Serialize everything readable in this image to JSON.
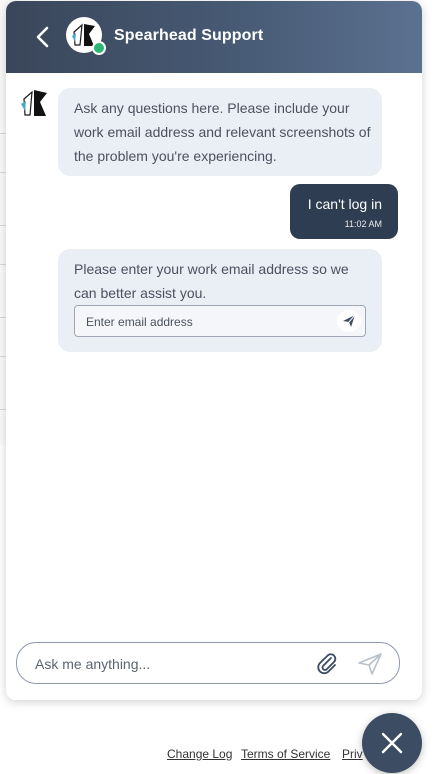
{
  "header": {
    "title": "Spearhead Support",
    "back_icon": "chevron-left-icon",
    "status_color": "#2bb673"
  },
  "messages": [
    {
      "from": "bot",
      "text": "Ask any questions here. Please include your work email address and relevant screenshots of the problem you're experiencing."
    },
    {
      "from": "user",
      "text": "I can't log in",
      "time": "11:02 AM"
    },
    {
      "from": "bot",
      "text": "Please enter your work email address so we can better assist you.",
      "input_placeholder": "Enter email address"
    }
  ],
  "composer": {
    "placeholder": "Ask me anything...",
    "attach_icon": "paperclip-icon",
    "send_icon": "send-icon"
  },
  "footer": {
    "links": [
      "Change Log",
      "Terms of Service",
      "Priv"
    ]
  },
  "colors": {
    "header_dark": "#3a465a",
    "user_bubble": "#2f3d52",
    "bot_bubble": "#eaeff6",
    "fab": "#3b4c63"
  }
}
